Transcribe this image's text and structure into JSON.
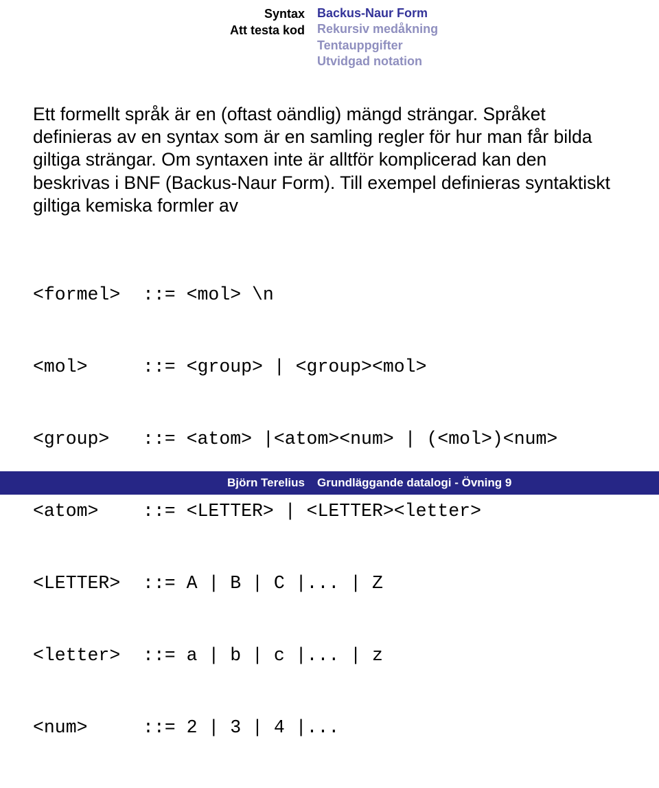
{
  "header": {
    "left": [
      "Syntax",
      "Att testa kod"
    ],
    "right": [
      {
        "text": "Backus-Naur Form",
        "faded": false
      },
      {
        "text": "Rekursiv medåkning",
        "faded": true
      },
      {
        "text": "Tentauppgifter",
        "faded": true
      },
      {
        "text": "Utvidgad notation",
        "faded": true
      }
    ]
  },
  "paragraph": "Ett formellt språk är en (oftast oändlig) mängd strängar. Språket definieras av en syntax som är en samling regler för hur man får bilda giltiga strängar. Om syntaxen inte är alltför komplicerad kan den beskrivas i BNF (Backus-Naur Form). Till exempel definieras syntaktiskt giltiga kemiska formler av",
  "bnf": [
    {
      "term": "<formel>",
      "def": "::= <mol> \\n"
    },
    {
      "term": "<mol>",
      "def": "::= <group> | <group><mol>"
    },
    {
      "term": "<group>",
      "def": "::= <atom> |<atom><num> | (<mol>)<num>"
    },
    {
      "term": "<atom>",
      "def": "::= <LETTER> | <LETTER><letter>"
    },
    {
      "term": "<LETTER>",
      "def": "::= A | B | C |... | Z"
    },
    {
      "term": "<letter>",
      "def": "::= a | b | c |... | z"
    },
    {
      "term": "<num>",
      "def": "::= 2 | 3 | 4 |..."
    }
  ],
  "footer": {
    "author": "Björn Terelius",
    "title": "Grundläggande datalogi - Övning 9"
  }
}
